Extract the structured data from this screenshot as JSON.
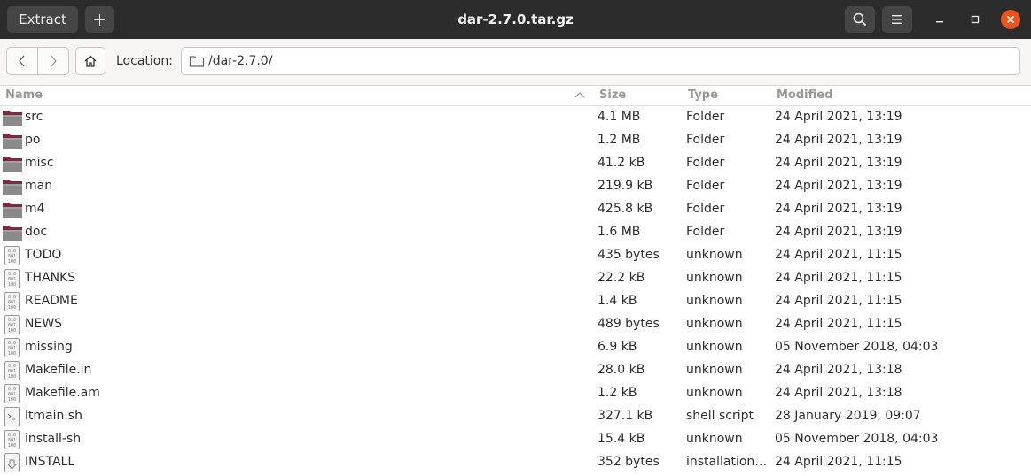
{
  "window": {
    "title": "dar-2.7.0.tar.gz",
    "extract_label": "Extract",
    "new_label": "+",
    "accent_color": "#e95420"
  },
  "toolbar": {
    "location_label": "Location:",
    "path": "/dar-2.7.0/"
  },
  "columns": {
    "name": "Name",
    "size": "Size",
    "type": "Type",
    "modified": "Modified"
  },
  "files": [
    {
      "name": "src",
      "size": "4.1 MB",
      "type": "Folder",
      "modified": "24 April 2021, 13:19",
      "icon": "folder-icon"
    },
    {
      "name": "po",
      "size": "1.2 MB",
      "type": "Folder",
      "modified": "24 April 2021, 13:19",
      "icon": "folder-icon"
    },
    {
      "name": "misc",
      "size": "41.2 kB",
      "type": "Folder",
      "modified": "24 April 2021, 13:19",
      "icon": "folder-icon"
    },
    {
      "name": "man",
      "size": "219.9 kB",
      "type": "Folder",
      "modified": "24 April 2021, 13:19",
      "icon": "folder-icon"
    },
    {
      "name": "m4",
      "size": "425.8 kB",
      "type": "Folder",
      "modified": "24 April 2021, 13:19",
      "icon": "folder-icon"
    },
    {
      "name": "doc",
      "size": "1.6 MB",
      "type": "Folder",
      "modified": "24 April 2021, 13:19",
      "icon": "folder-icon"
    },
    {
      "name": "TODO",
      "size": "435 bytes",
      "type": "unknown",
      "modified": "24 April 2021, 11:15",
      "icon": "binary-file-icon"
    },
    {
      "name": "THANKS",
      "size": "22.2 kB",
      "type": "unknown",
      "modified": "24 April 2021, 11:15",
      "icon": "binary-file-icon"
    },
    {
      "name": "README",
      "size": "1.4 kB",
      "type": "unknown",
      "modified": "24 April 2021, 11:15",
      "icon": "binary-file-icon"
    },
    {
      "name": "NEWS",
      "size": "489 bytes",
      "type": "unknown",
      "modified": "24 April 2021, 11:15",
      "icon": "binary-file-icon"
    },
    {
      "name": "missing",
      "size": "6.9 kB",
      "type": "unknown",
      "modified": "05 November 2018, 04:03",
      "icon": "binary-file-icon"
    },
    {
      "name": "Makefile.in",
      "size": "28.0 kB",
      "type": "unknown",
      "modified": "24 April 2021, 13:18",
      "icon": "binary-file-icon"
    },
    {
      "name": "Makefile.am",
      "size": "1.2 kB",
      "type": "unknown",
      "modified": "24 April 2021, 13:18",
      "icon": "binary-file-icon"
    },
    {
      "name": "ltmain.sh",
      "size": "327.1 kB",
      "type": "shell script",
      "modified": "28 January 2019, 09:07",
      "icon": "script-file-icon"
    },
    {
      "name": "install-sh",
      "size": "15.4 kB",
      "type": "unknown",
      "modified": "05 November 2018, 04:03",
      "icon": "binary-file-icon"
    },
    {
      "name": "INSTALL",
      "size": "352 bytes",
      "type": "installation…",
      "modified": "24 April 2021, 11:15",
      "icon": "install-file-icon"
    }
  ]
}
